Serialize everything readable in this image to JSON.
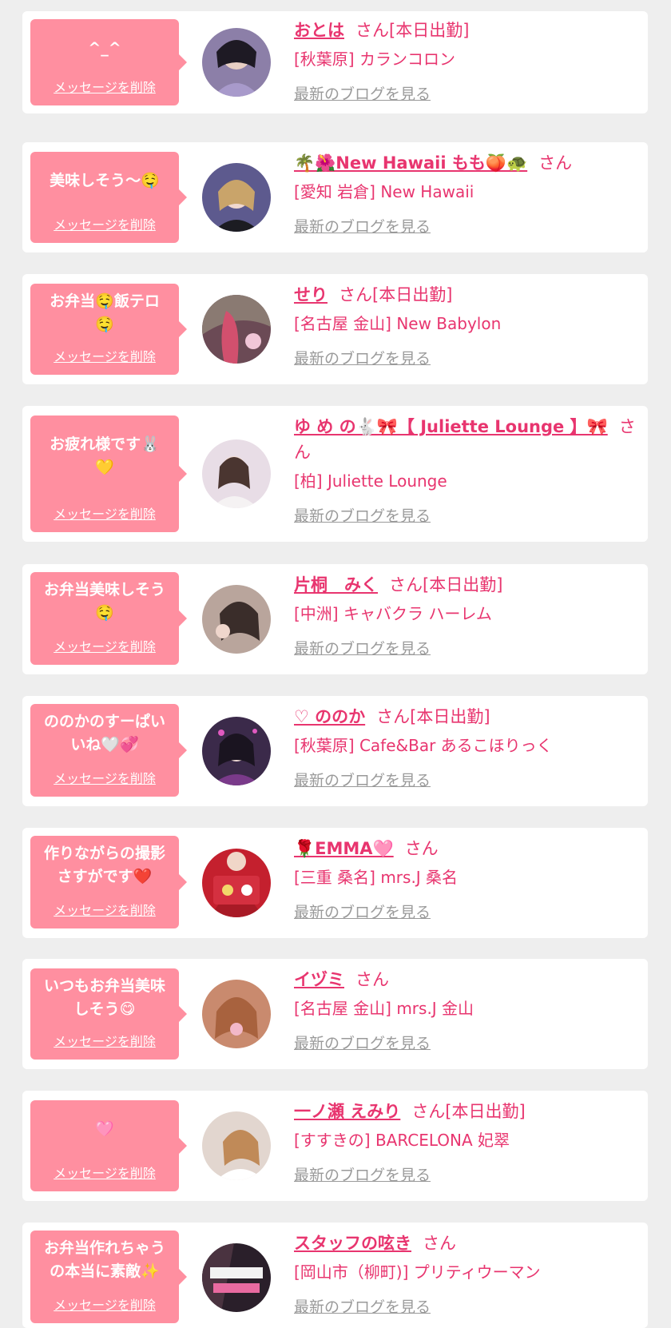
{
  "labels": {
    "delete": "メッセージを削除",
    "blog": "最新のブログを見る"
  },
  "cards": [
    {
      "message": "^_^",
      "name": "おとは",
      "honorific": "さん[本日出勤]",
      "shop": "[秋葉原] カランコロン",
      "avatar_color": "#8c7fa8"
    },
    {
      "message": "美味しそう〜🤤",
      "name": "🌴🌺New Hawaii もも🍑🐢",
      "honorific": "さん",
      "shop": "[愛知 岩倉] New Hawaii",
      "avatar_color": "#5d5a8e"
    },
    {
      "message": "お弁当🤤飯テロ🤤",
      "name": "せり",
      "honorific": "さん[本日出勤]",
      "shop": "[名古屋 金山] New Babylon",
      "avatar_color": "#6b4a55"
    },
    {
      "message": "お疲れ様です🐰💛",
      "name": "ゆ め の🐇🎀【 Juliette Lounge 】🎀",
      "honorific": "さん",
      "shop": "[柏] Juliette Lounge",
      "avatar_color": "#e8dde6"
    },
    {
      "message": "お弁当美味しそう🤤",
      "name": "片桐　みく",
      "honorific": "さん[本日出勤]",
      "shop": "[中洲] キャバクラ ハーレム",
      "avatar_color": "#b9a59c"
    },
    {
      "message": "ののかのすーぱいいね🤍💞",
      "name": "♡ ののか",
      "honorific": "さん[本日出勤]",
      "shop": "[秋葉原] Cafe&Bar あるこほりっく",
      "avatar_color": "#3b2a4a"
    },
    {
      "message": "作りながらの撮影さすがです❤️",
      "name": "🌹EMMA🩷",
      "honorific": "さん",
      "shop": "[三重 桑名] mrs.J 桑名",
      "avatar_color": "#c4202e"
    },
    {
      "message": "いつもお弁当美味しそう😋",
      "name": "イヅミ",
      "honorific": "さん",
      "shop": "[名古屋 金山] mrs.J 金山",
      "avatar_color": "#c98a6e"
    },
    {
      "message": "🩷",
      "name": "一ノ瀬 えみり",
      "honorific": "さん[本日出勤]",
      "shop": "[すすきの] BARCELONA 妃翠",
      "avatar_color": "#e2d6cf"
    },
    {
      "message": "お弁当作れちゃうの本当に素敵✨",
      "name": "スタッフの呟き",
      "honorific": "さん",
      "shop": "[岡山市（柳町)] プリティウーマン",
      "avatar_color": "#2a1f2a"
    }
  ]
}
